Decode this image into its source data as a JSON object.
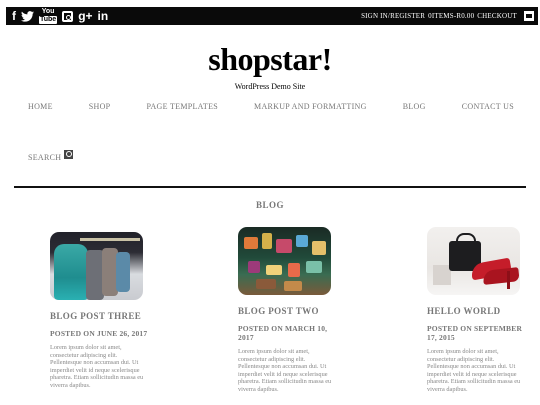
{
  "topbar": {
    "social": [
      {
        "icon": "facebook-icon",
        "glyph": "f"
      },
      {
        "icon": "twitter-icon",
        "glyph": "🐦"
      },
      {
        "icon": "youtube-icon",
        "glyph_top": "You",
        "glyph_bottom": "Tube"
      },
      {
        "icon": "instagram-icon",
        "glyph": ""
      },
      {
        "icon": "google-plus-icon",
        "glyph": "g+"
      },
      {
        "icon": "linkedin-icon",
        "glyph": "in"
      }
    ],
    "account_link": "SIGN IN/REGISTER",
    "cart_items": "0ITEMS-R0.00",
    "checkout_link": "CHECKOUT"
  },
  "brand": {
    "title": "shopstar!",
    "tagline": "WordPress Demo Site"
  },
  "nav": {
    "items": [
      "HOME",
      "SHOP",
      "PAGE TEMPLATES",
      "MARKUP AND FORMATTING",
      "BLOG",
      "CONTACT US"
    ],
    "search_label": "SEARCH"
  },
  "section": {
    "title": "BLOG"
  },
  "posts": [
    {
      "title": "BLOG POST THREE",
      "date": "POSTED ON JUNE 26, 2017",
      "excerpt": "Lorem ipsum dolor sit amet, consectetur adipiscing elit. Pellentesque non accumsan dui. Ut imperdiet velit id neque scelerisque pharetra. Etiam sollicitudin massa eu viverra dapibus."
    },
    {
      "title": "BLOG POST TWO",
      "date": "POSTED ON MARCH 10, 2017",
      "excerpt": "Lorem ipsum dolor sit amet, consectetur adipiscing elit. Pellentesque non accumsan dui. Ut imperdiet velit id neque scelerisque pharetra. Etiam sollicitudin massa eu viverra dapibus."
    },
    {
      "title": "HELLO WORLD",
      "date": "POSTED ON SEPTEMBER 17, 2015",
      "excerpt": "Lorem ipsum dolor sit amet, consectetur adipiscing elit. Pellentesque non accumsan dui. Ut imperdiet velit id neque scelerisque pharetra. Etiam sollicitudin massa eu viverra dapibus."
    }
  ]
}
